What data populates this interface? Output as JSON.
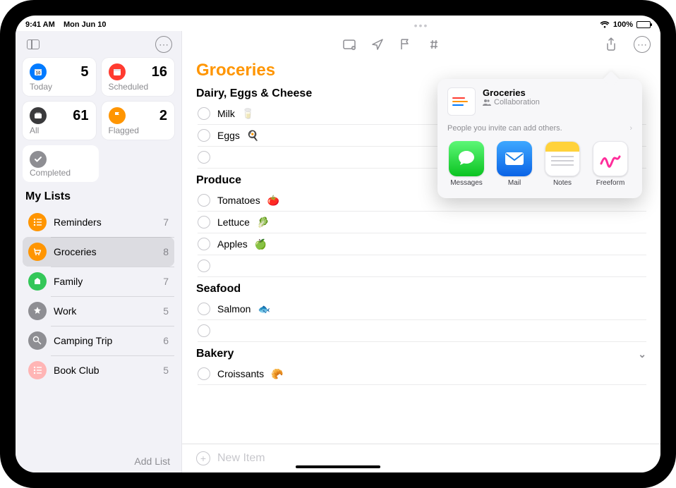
{
  "statusbar": {
    "time": "9:41 AM",
    "date": "Mon Jun 10",
    "battery_pct": "100%"
  },
  "sidebar": {
    "smart": [
      {
        "key": "today",
        "label": "Today",
        "count": "5",
        "color": "#007aff"
      },
      {
        "key": "scheduled",
        "label": "Scheduled",
        "count": "16",
        "color": "#ff3b30"
      },
      {
        "key": "all",
        "label": "All",
        "count": "61",
        "color": "#3a3a3c"
      },
      {
        "key": "flagged",
        "label": "Flagged",
        "count": "2",
        "color": "#ff9500"
      }
    ],
    "completed_label": "Completed",
    "mylists_title": "My Lists",
    "lists": [
      {
        "name": "Reminders",
        "count": "7",
        "color": "#ff9500",
        "selected": false
      },
      {
        "name": "Groceries",
        "count": "8",
        "color": "#ff9500",
        "selected": true
      },
      {
        "name": "Family",
        "count": "7",
        "color": "#34c759",
        "selected": false
      },
      {
        "name": "Work",
        "count": "5",
        "color": "#8e8e93",
        "selected": false
      },
      {
        "name": "Camping Trip",
        "count": "6",
        "color": "#8e8e93",
        "selected": false
      },
      {
        "name": "Book Club",
        "count": "5",
        "color": "#ffb5b5",
        "selected": false
      }
    ],
    "add_list_label": "Add List"
  },
  "main": {
    "title": "Groceries",
    "title_color": "#ff9500",
    "sections": [
      {
        "title": "Dairy, Eggs & Cheese",
        "items": [
          {
            "label": "Milk",
            "emoji": "🥛"
          },
          {
            "label": "Eggs",
            "emoji": "🍳"
          }
        ],
        "trailing_empty": true
      },
      {
        "title": "Produce",
        "items": [
          {
            "label": "Tomatoes",
            "emoji": "🍅"
          },
          {
            "label": "Lettuce",
            "emoji": "🥬"
          },
          {
            "label": "Apples",
            "emoji": "🍏"
          }
        ],
        "trailing_empty": true
      },
      {
        "title": "Seafood",
        "items": [
          {
            "label": "Salmon",
            "emoji": "🐟"
          }
        ],
        "trailing_empty": true
      },
      {
        "title": "Bakery",
        "items": [
          {
            "label": "Croissants",
            "emoji": "🥐"
          }
        ],
        "collapsed_chevron": true
      }
    ],
    "new_item_label": "New Item"
  },
  "share_sheet": {
    "title": "Groceries",
    "subtitle": "Collaboration",
    "invite_text": "People you invite can add others.",
    "apps": [
      {
        "key": "messages",
        "label": "Messages"
      },
      {
        "key": "mail",
        "label": "Mail"
      },
      {
        "key": "notes",
        "label": "Notes"
      },
      {
        "key": "freeform",
        "label": "Freeform"
      }
    ]
  }
}
